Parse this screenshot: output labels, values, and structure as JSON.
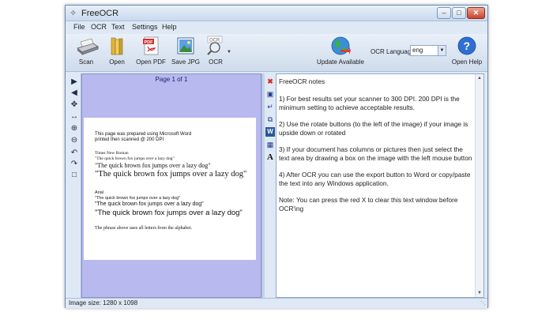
{
  "window": {
    "title": "FreeOCR",
    "min_icon": "minimize-icon",
    "max_icon": "maximize-icon",
    "close_icon": "close-icon"
  },
  "menu": [
    "File",
    "OCR",
    "Text",
    "Settings",
    "Help"
  ],
  "toolbar": {
    "scan": "Scan",
    "open": "Open",
    "open_pdf": "Open PDF",
    "save_jpg": "Save JPG",
    "ocr": "OCR",
    "update": "Update Available",
    "language_label": "OCR Language:",
    "language_value": "eng",
    "help": "Open Help"
  },
  "image_pane": {
    "page_label": "Page 1 of 1",
    "lines": [
      "This page was prepared using Microsoft Word",
      "printed then scanned @ 200 DPI",
      "Times New Roman",
      "\"The quick brown fox jumps over a lazy dog\"",
      "\"The quick brown fox jumps over a lazy dog\"",
      "\"The quick brown fox jumps over a lazy dog\"",
      "Arial",
      "\"The quick brown fox jumps over a lazy dog\"",
      "\"The quick brown fox jumps over a lazy dog\"",
      "\"The quick brown fox jumps over a lazy dog\"",
      "The phrase above uses all letters from the alphabet."
    ]
  },
  "notes": {
    "title": "FreeOCR notes",
    "items": [
      "1) For best results set your scanner to 300 DPI. 200 DPI is the minimum setting to achieve acceptable results.",
      "2) Use the rotate buttons (to the left of the image) if your image is upside down or rotated",
      "3) If your document has columns or pictures then just select the text area by drawing a box on the image with the left mouse button",
      "4) After OCR you can use the export button to Word or copy/paste the text into any Windows application.",
      "Note: You can press the red X to clear this text window before OCR'ing"
    ]
  },
  "status": {
    "image_size": "Image size: 1280 x 1098"
  }
}
